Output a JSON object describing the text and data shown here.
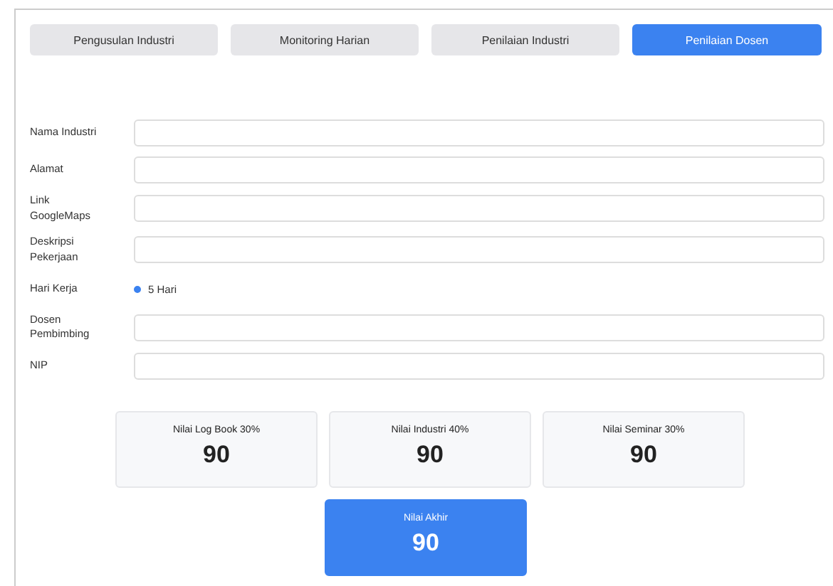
{
  "tabs": [
    {
      "label": "Pengusulan Industri",
      "selected": false
    },
    {
      "label": "Monitoring Harian",
      "selected": false
    },
    {
      "label": "Penilaian Industri",
      "selected": false
    },
    {
      "label": "Penilaian Dosen",
      "selected": true
    }
  ],
  "form": [
    {
      "kind": "text",
      "label": "Nama Industri"
    },
    {
      "kind": "text",
      "label": "Alamat"
    },
    {
      "kind": "text",
      "label": "Link GoogleMaps"
    },
    {
      "kind": "text",
      "label": "Deskripsi Pekerjaan"
    },
    {
      "kind": "radio",
      "label": "Hari Kerja",
      "options": [
        {
          "label": "5 Hari",
          "selected": true
        }
      ]
    },
    {
      "kind": "text",
      "label": "Dosen Pembimbing"
    },
    {
      "kind": "text",
      "label": "NIP"
    }
  ],
  "scores": [
    {
      "label": "Nilai Log Book 30%",
      "value": "90"
    },
    {
      "label": "Nilai Industri 40%",
      "value": "90"
    },
    {
      "label": "Nilai Seminar 30%",
      "value": "90"
    }
  ],
  "final_score": {
    "label": "Nilai Akhir",
    "value": "90"
  }
}
